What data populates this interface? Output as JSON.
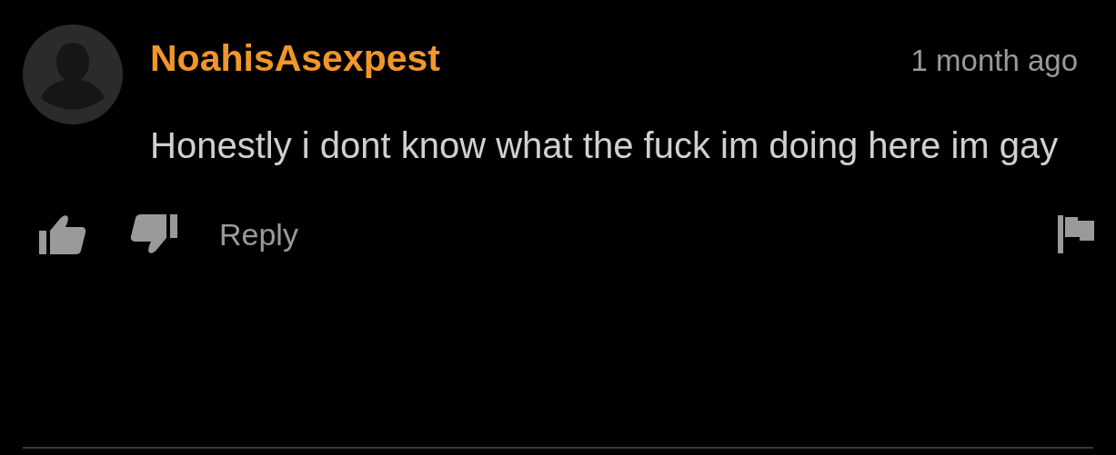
{
  "comment": {
    "author": "NoahisAsexpest",
    "time": "1 month ago",
    "text": "Honestly i dont know what the fuck im doing here im gay",
    "reply_label": "Reply"
  }
}
